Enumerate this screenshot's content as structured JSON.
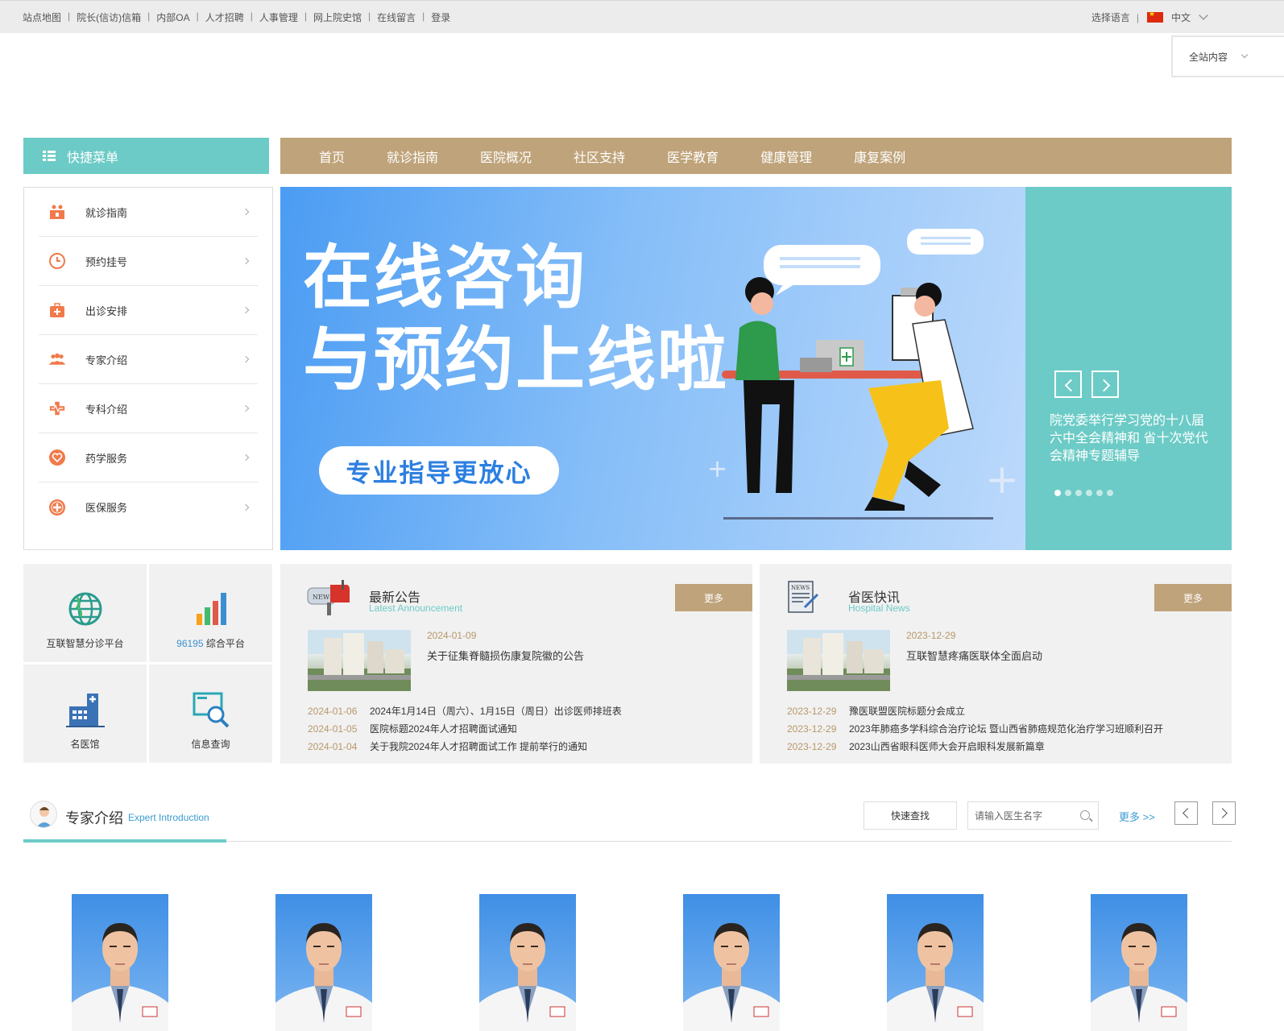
{
  "topbar": {
    "links": [
      "站点地图",
      "院长(信访)信箱",
      "内部OA",
      "人才招聘",
      "人事管理",
      "网上院史馆",
      "在线留言",
      "登录"
    ],
    "language_label": "选择语言",
    "language_value": "中文"
  },
  "site_search": {
    "scope": "全站内容"
  },
  "quick_menu": {
    "title": "快捷菜单",
    "items": [
      {
        "label": "就诊指南",
        "icon": "family-icon"
      },
      {
        "label": "预约挂号",
        "icon": "clock-icon"
      },
      {
        "label": "出诊安排",
        "icon": "medical-kit-icon"
      },
      {
        "label": "专家介绍",
        "icon": "group-icon"
      },
      {
        "label": "专科介绍",
        "icon": "medical-cross-icon"
      },
      {
        "label": "药学服务",
        "icon": "heart-icon"
      },
      {
        "label": "医保服务",
        "icon": "plus-circle-icon"
      }
    ]
  },
  "nav": {
    "items": [
      "首页",
      "就诊指南",
      "医院概况",
      "社区支持",
      "医学教育",
      "健康管理",
      "康复案例"
    ]
  },
  "banner": {
    "line1": "在线咨询",
    "line2": "与预约上线啦",
    "pill": "专业指导更放心"
  },
  "slider": {
    "caption": "院党委举行学习党的十八届六中全会精神和 省十次党代会精神专题辅导",
    "dot_count": 6,
    "active_dot": 0
  },
  "tiles": [
    {
      "label": "互联智慧分诊平台",
      "icon": "globe-icon"
    },
    {
      "highlight": "96195",
      "label": " 综合平台",
      "icon": "bar-chart-icon"
    },
    {
      "label": "名医馆",
      "icon": "hospital-building-icon"
    },
    {
      "label": "信息查询",
      "icon": "search-screen-icon"
    }
  ],
  "announcements": {
    "title": "最新公告",
    "subtitle": "Latest Announcement",
    "more": "更多",
    "featured": {
      "date": "2024-01-09",
      "title": "关于征集脊髓损伤康复院徽的公告"
    },
    "items": [
      {
        "date": "2024-01-06",
        "title": "2024年1月14日（周六）、1月15日（周日）出诊医师排班表"
      },
      {
        "date": "2024-01-05",
        "title": "医院标题2024年人才招聘面试通知"
      },
      {
        "date": "2024-01-04",
        "title": "关于我院2024年人才招聘面试工作 提前举行的通知"
      }
    ]
  },
  "news": {
    "title": "省医快讯",
    "subtitle": "Hospital News",
    "more": "更多",
    "featured": {
      "date": "2023-12-29",
      "title": "互联智慧疼痛医联体全面启动"
    },
    "items": [
      {
        "date": "2023-12-29",
        "title": "豫医联盟医院标题分会成立"
      },
      {
        "date": "2023-12-29",
        "title": "2023年肺癌多学科综合治疗论坛 暨山西省肺癌规范化治疗学习班顺利召开"
      },
      {
        "date": "2023-12-29",
        "title": "2023山西省眼科医师大会开启眼科发展新篇章"
      }
    ]
  },
  "experts": {
    "title": "专家介绍",
    "subtitle": "Expert Introduction",
    "quick_find": "快速查找",
    "search_placeholder": "请输入医生名字",
    "more": "更多 >>",
    "doctor_count": 6
  },
  "colors": {
    "teal": "#6ccbc6",
    "gold": "#bfa37a",
    "banner_blue": "#4b9cf3",
    "date_gold": "#b7986a"
  }
}
